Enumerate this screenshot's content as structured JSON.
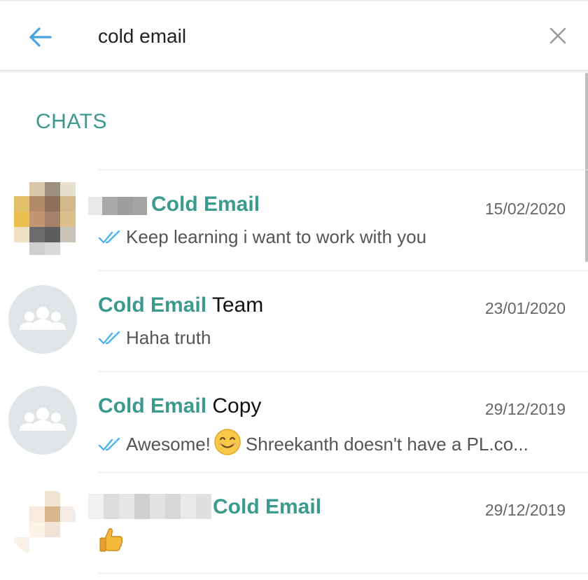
{
  "search": {
    "query": "cold email"
  },
  "section": {
    "title": "CHATS"
  },
  "chats": [
    {
      "title_match": "Cold Email",
      "title_rest": "",
      "date": "15/02/2020",
      "preview": "Keep learning i want to work with you"
    },
    {
      "title_match": "Cold Email",
      "title_rest": " Team",
      "date": "23/01/2020",
      "preview": "Haha truth"
    },
    {
      "title_match": "Cold Email",
      "title_rest": " Copy",
      "date": "29/12/2019",
      "preview_before": "Awesome!",
      "preview_after": "Shreekanth doesn't have a PL.co..."
    },
    {
      "title_match": "Cold Email",
      "title_rest": "",
      "date": "29/12/2019",
      "preview": "👍"
    }
  ],
  "colors": {
    "accent": "#3b9a8e",
    "tick_blue": "#4fb6ec",
    "back_arrow": "#4aa3df"
  },
  "icons": [
    "back-arrow-icon",
    "close-icon",
    "group-icon",
    "double-check-icon",
    "smiling-emoji-icon",
    "thumbs-up-icon"
  ]
}
